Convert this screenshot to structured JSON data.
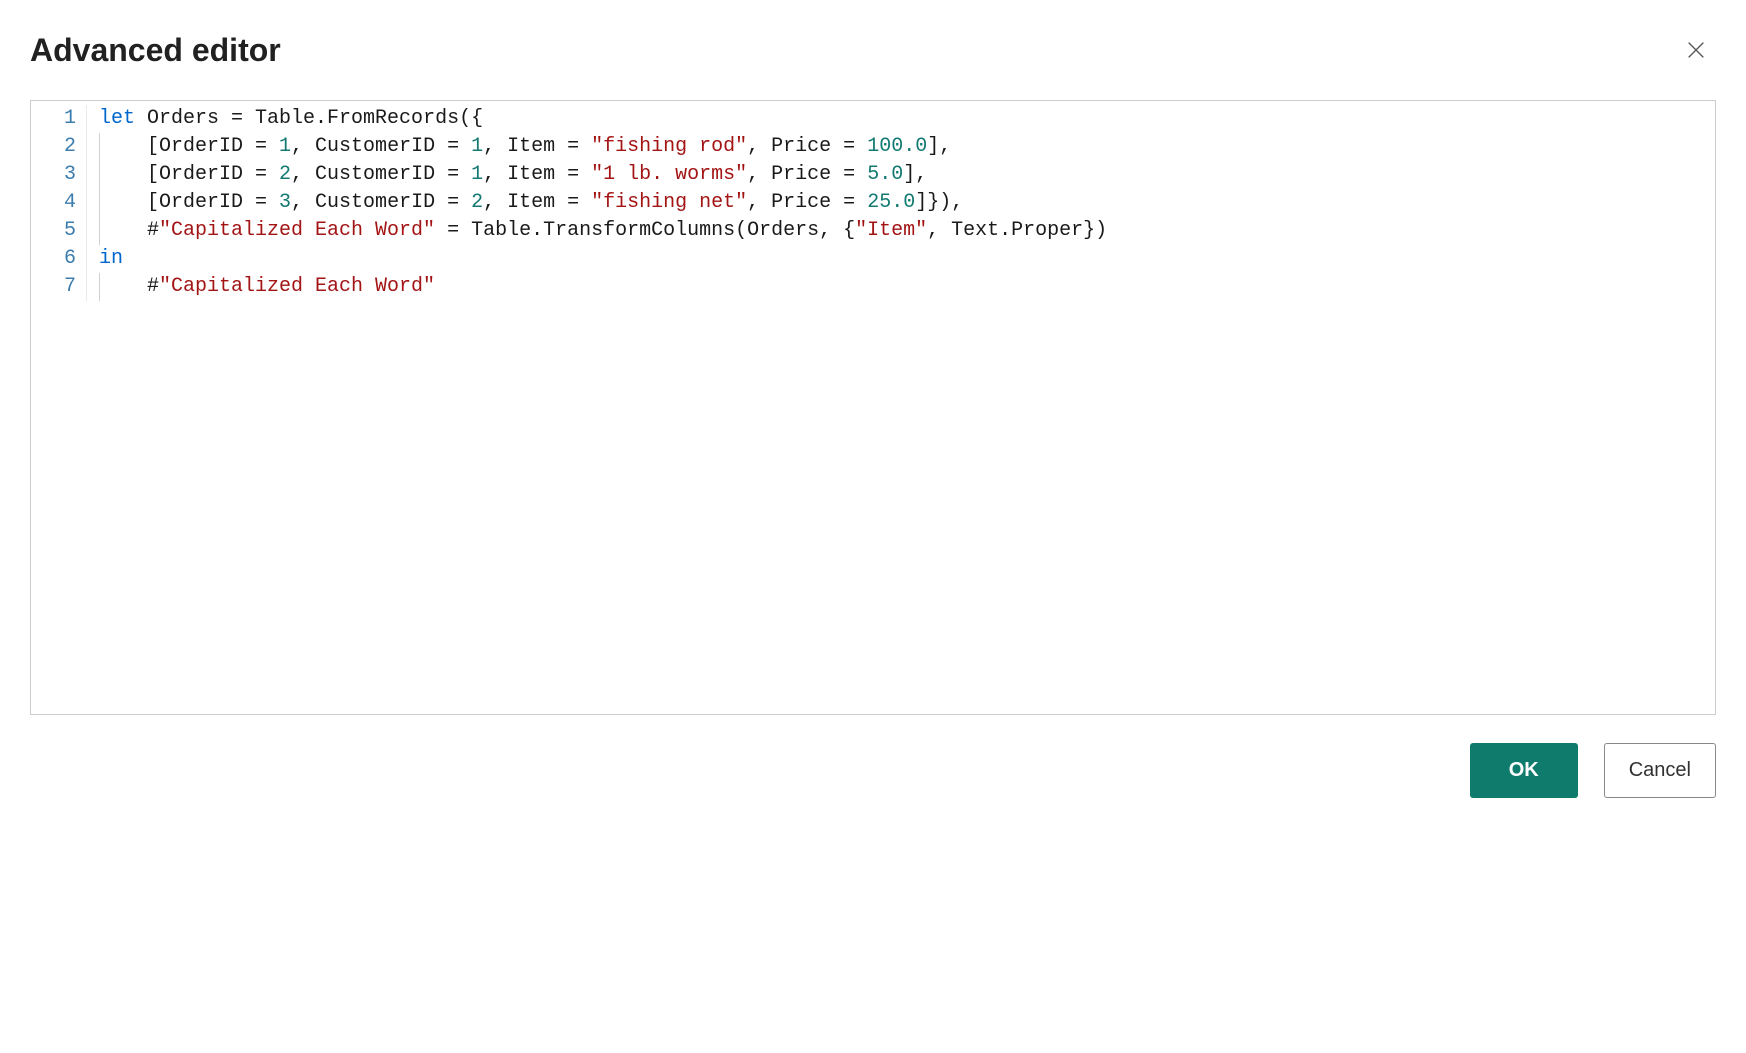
{
  "dialog": {
    "title": "Advanced editor",
    "ok_label": "OK",
    "cancel_label": "Cancel"
  },
  "editor": {
    "lines": [
      {
        "num": "1",
        "indent": 0,
        "tokens": [
          {
            "t": "let",
            "cls": "tok-keyword"
          },
          {
            "t": " Orders = Table.FromRecords({",
            "cls": "tok-default"
          }
        ]
      },
      {
        "num": "2",
        "indent": 1,
        "tokens": [
          {
            "t": "    [OrderID = ",
            "cls": "tok-default"
          },
          {
            "t": "1",
            "cls": "tok-number"
          },
          {
            "t": ", CustomerID = ",
            "cls": "tok-default"
          },
          {
            "t": "1",
            "cls": "tok-number"
          },
          {
            "t": ", Item = ",
            "cls": "tok-default"
          },
          {
            "t": "\"fishing rod\"",
            "cls": "tok-string"
          },
          {
            "t": ", Price = ",
            "cls": "tok-default"
          },
          {
            "t": "100.0",
            "cls": "tok-number"
          },
          {
            "t": "],",
            "cls": "tok-default"
          }
        ]
      },
      {
        "num": "3",
        "indent": 1,
        "tokens": [
          {
            "t": "    [OrderID = ",
            "cls": "tok-default"
          },
          {
            "t": "2",
            "cls": "tok-number"
          },
          {
            "t": ", CustomerID = ",
            "cls": "tok-default"
          },
          {
            "t": "1",
            "cls": "tok-number"
          },
          {
            "t": ", Item = ",
            "cls": "tok-default"
          },
          {
            "t": "\"1 lb. worms\"",
            "cls": "tok-string"
          },
          {
            "t": ", Price = ",
            "cls": "tok-default"
          },
          {
            "t": "5.0",
            "cls": "tok-number"
          },
          {
            "t": "],",
            "cls": "tok-default"
          }
        ]
      },
      {
        "num": "4",
        "indent": 1,
        "tokens": [
          {
            "t": "    [OrderID = ",
            "cls": "tok-default"
          },
          {
            "t": "3",
            "cls": "tok-number"
          },
          {
            "t": ", CustomerID = ",
            "cls": "tok-default"
          },
          {
            "t": "2",
            "cls": "tok-number"
          },
          {
            "t": ", Item = ",
            "cls": "tok-default"
          },
          {
            "t": "\"fishing net\"",
            "cls": "tok-string"
          },
          {
            "t": ", Price = ",
            "cls": "tok-default"
          },
          {
            "t": "25.0",
            "cls": "tok-number"
          },
          {
            "t": "]}),",
            "cls": "tok-default"
          }
        ]
      },
      {
        "num": "5",
        "indent": 1,
        "tokens": [
          {
            "t": "    #",
            "cls": "tok-default"
          },
          {
            "t": "\"Capitalized Each Word\"",
            "cls": "tok-string"
          },
          {
            "t": " = Table.TransformColumns(Orders, {",
            "cls": "tok-default"
          },
          {
            "t": "\"Item\"",
            "cls": "tok-string"
          },
          {
            "t": ", Text.Proper})",
            "cls": "tok-default"
          }
        ]
      },
      {
        "num": "6",
        "indent": 0,
        "tokens": [
          {
            "t": "in",
            "cls": "tok-keyword"
          }
        ]
      },
      {
        "num": "7",
        "indent": 1,
        "tokens": [
          {
            "t": "    #",
            "cls": "tok-default"
          },
          {
            "t": "\"Capitalized Each Word\"",
            "cls": "tok-string"
          }
        ]
      }
    ]
  }
}
